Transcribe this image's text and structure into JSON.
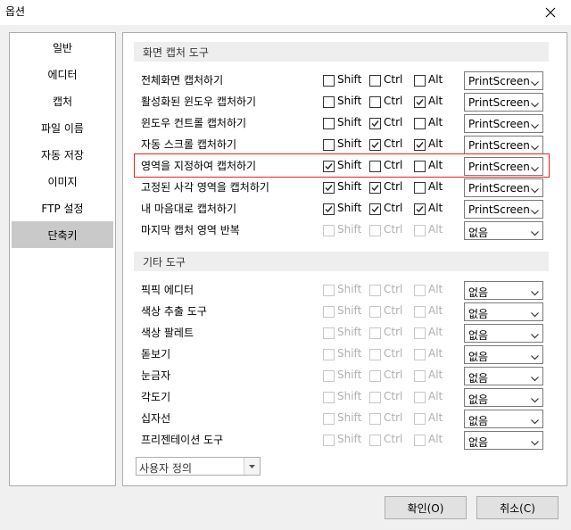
{
  "window": {
    "title": "옵션"
  },
  "sidebar": {
    "items": [
      "일반",
      "에디터",
      "캡처",
      "파일 이름",
      "자동 저장",
      "이미지",
      "FTP 설정",
      "단축키"
    ],
    "selected_index": 7
  },
  "sections": [
    {
      "title": "화면 캡처 도구",
      "rows": [
        {
          "label": "전체화면 캡처하기",
          "shift": false,
          "ctrl": false,
          "alt": false,
          "key": "PrintScreen",
          "enabled": true
        },
        {
          "label": "활성화된 윈도우 캡처하기",
          "shift": false,
          "ctrl": false,
          "alt": true,
          "key": "PrintScreen",
          "enabled": true
        },
        {
          "label": "윈도우 컨트롤 캡처하기",
          "shift": false,
          "ctrl": true,
          "alt": false,
          "key": "PrintScreen",
          "enabled": true
        },
        {
          "label": "자동 스크롤 캡처하기",
          "shift": false,
          "ctrl": true,
          "alt": true,
          "key": "PrintScreen",
          "enabled": true
        },
        {
          "label": "영역을 지정하여 캡처하기",
          "shift": true,
          "ctrl": false,
          "alt": false,
          "key": "PrintScreen",
          "enabled": true,
          "highlighted": true
        },
        {
          "label": "고정된 사각 영역을 캡처하기",
          "shift": true,
          "ctrl": true,
          "alt": false,
          "key": "PrintScreen",
          "enabled": true
        },
        {
          "label": "내 마음대로 캡처하기",
          "shift": true,
          "ctrl": true,
          "alt": true,
          "key": "PrintScreen",
          "enabled": true
        },
        {
          "label": "마지막 캡처 영역 반복",
          "shift": false,
          "ctrl": false,
          "alt": false,
          "key": "없음",
          "enabled": false
        }
      ]
    },
    {
      "title": "기타 도구",
      "rows": [
        {
          "label": "픽픽 에디터",
          "shift": false,
          "ctrl": false,
          "alt": false,
          "key": "없음",
          "enabled": false
        },
        {
          "label": "색상 추출 도구",
          "shift": false,
          "ctrl": false,
          "alt": false,
          "key": "없음",
          "enabled": false
        },
        {
          "label": "색상 팔레트",
          "shift": false,
          "ctrl": false,
          "alt": false,
          "key": "없음",
          "enabled": false
        },
        {
          "label": "돋보기",
          "shift": false,
          "ctrl": false,
          "alt": false,
          "key": "없음",
          "enabled": false
        },
        {
          "label": "눈금자",
          "shift": false,
          "ctrl": false,
          "alt": false,
          "key": "없음",
          "enabled": false
        },
        {
          "label": "각도기",
          "shift": false,
          "ctrl": false,
          "alt": false,
          "key": "없음",
          "enabled": false
        },
        {
          "label": "십자선",
          "shift": false,
          "ctrl": false,
          "alt": false,
          "key": "없음",
          "enabled": false
        },
        {
          "label": "프리젠테이션 도구",
          "shift": false,
          "ctrl": false,
          "alt": false,
          "key": "없음",
          "enabled": false
        }
      ]
    }
  ],
  "modifiers": {
    "shift": "Shift",
    "ctrl": "Ctrl",
    "alt": "Alt"
  },
  "preset": {
    "value": "사용자 정의"
  },
  "buttons": {
    "ok": "확인(O)",
    "cancel": "취소(C)"
  },
  "colors": {
    "highlight": "#e8211b",
    "selected_bg": "#c9c9c9"
  }
}
